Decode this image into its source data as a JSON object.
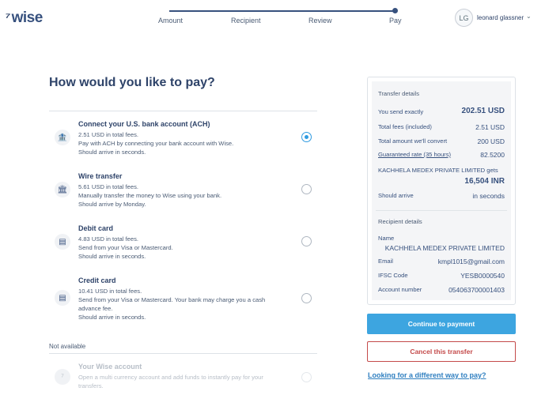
{
  "header": {
    "logo_flag": "⁷",
    "logo_text": "wise",
    "steps": [
      "Amount",
      "Recipient",
      "Review",
      "Pay"
    ],
    "avatar_initials": "LG",
    "username": "leonard glassner"
  },
  "page": {
    "title": "How would you like to pay?",
    "not_available_label": "Not available"
  },
  "options": [
    {
      "title": "Connect your U.S. bank account (ACH)",
      "fee": "2.51 USD in total fees.",
      "line1": "Pay with ACH by connecting your bank account with Wise.",
      "line2": "Should arrive in seconds.",
      "selected": true
    },
    {
      "title": "Wire transfer",
      "fee": "5.61 USD in total fees.",
      "line1": "Manually transfer the money to Wise using your bank.",
      "line2": "Should arrive by Monday.",
      "selected": false
    },
    {
      "title": "Debit card",
      "fee": "4.83 USD in total fees.",
      "line1": "Send from your Visa or Mastercard.",
      "line2": "Should arrive in seconds.",
      "selected": false
    },
    {
      "title": "Credit card",
      "fee": "10.41 USD in total fees.",
      "line1": "Send from your Visa or Mastercard. Your bank may charge you a cash advance fee.",
      "line2": "Should arrive in seconds.",
      "selected": false
    }
  ],
  "unavailable": {
    "title": "Your Wise account",
    "text": "Open a multi currency account and add funds to instantly pay for your transfers."
  },
  "transfer_details": {
    "heading": "Transfer details",
    "you_send_label": "You send exactly",
    "you_send_value": "202.51 USD",
    "fees_label": "Total fees (included)",
    "fees_value": "2.51 USD",
    "convert_label": "Total amount we'll convert",
    "convert_value": "200 USD",
    "rate_label": "Guaranteed rate (35 hours)",
    "rate_value": "82.5200",
    "recipient_gets_label": "KACHHELA MEDEX PRIVATE LIMITED gets",
    "recipient_gets_value": "16,504 INR",
    "arrive_label": "Should arrive",
    "arrive_value": "in seconds"
  },
  "recipient_details": {
    "heading": "Recipient details",
    "name_label": "Name",
    "name_value": "KACHHELA MEDEX PRIVATE LIMITED",
    "email_label": "Email",
    "email_value": "kmpl1015@gmail.com",
    "ifsc_label": "IFSC Code",
    "ifsc_value": "YESB0000540",
    "account_label": "Account number",
    "account_value": "054063700001403"
  },
  "actions": {
    "continue_label": "Continue to payment",
    "cancel_label": "Cancel this transfer",
    "alt_link": "Looking for a different way to pay?"
  },
  "colors": {
    "primary": "#3da5e0",
    "danger": "#c44a4a",
    "navy": "#2e4369"
  }
}
